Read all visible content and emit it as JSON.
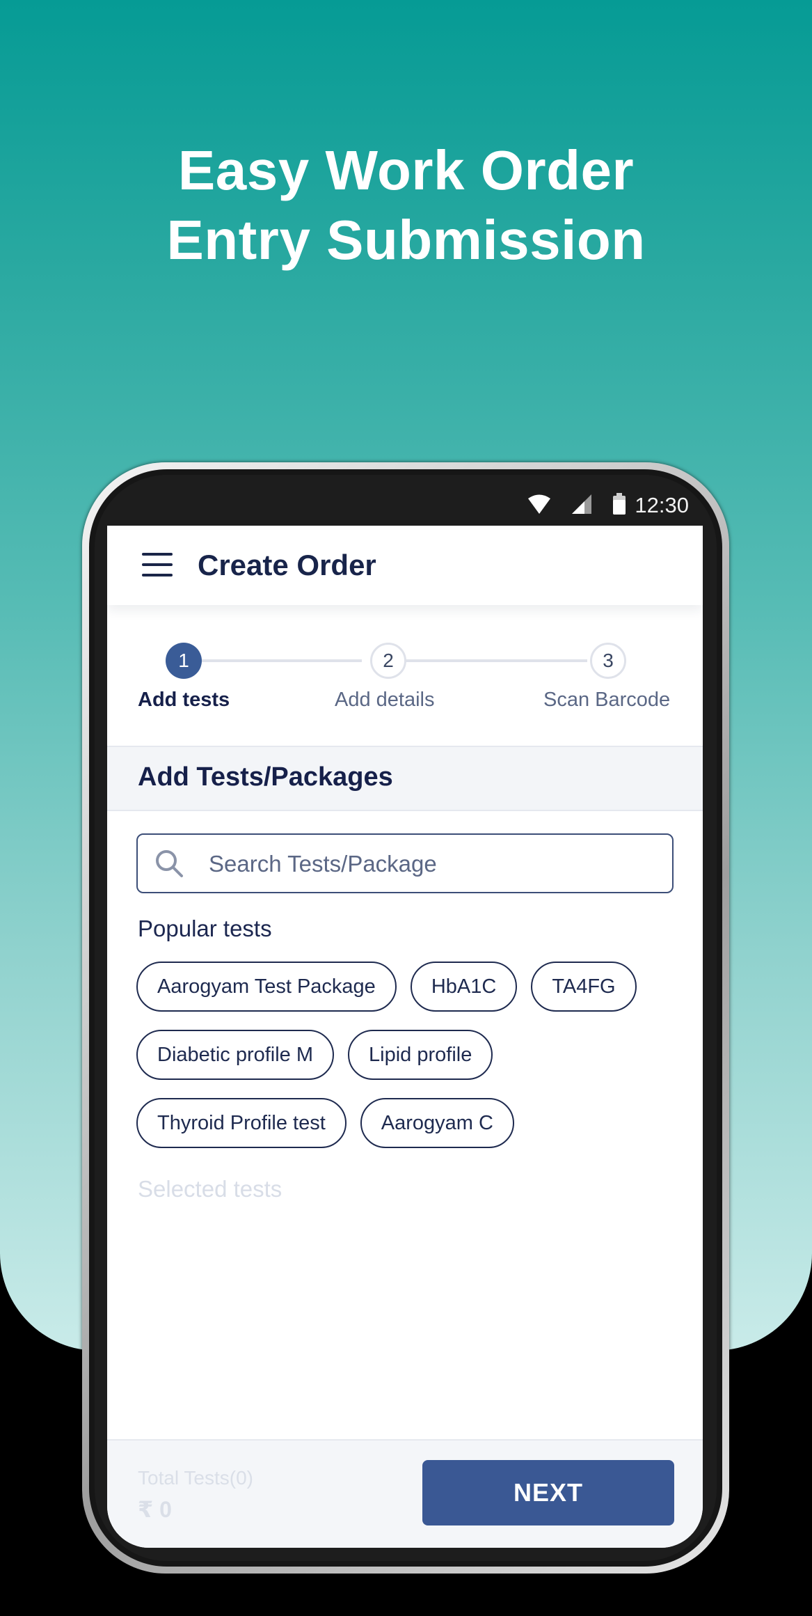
{
  "promo": {
    "headline_line1": "Easy Work Order",
    "headline_line2": "Entry Submission"
  },
  "status_bar": {
    "time": "12:30",
    "icons": [
      "wifi-icon",
      "signal-icon",
      "battery-icon"
    ]
  },
  "app_bar": {
    "title": "Create Order",
    "menu_icon": "menu-icon"
  },
  "stepper": {
    "steps": [
      {
        "number": "1",
        "label": "Add tests",
        "active": true
      },
      {
        "number": "2",
        "label": "Add details",
        "active": false
      },
      {
        "number": "3",
        "label": "Scan Barcode",
        "active": false
      }
    ]
  },
  "section": {
    "title": "Add Tests/Packages"
  },
  "search": {
    "placeholder": "Search Tests/Package",
    "value": ""
  },
  "popular": {
    "title": "Popular tests",
    "rows": [
      [
        "Aarogyam Test Package",
        "HbA1C",
        "TA4FG"
      ],
      [
        "Diabetic profile M",
        "Lipid profile"
      ],
      [
        "Thyroid Profile test",
        "Aarogyam C"
      ]
    ]
  },
  "selected": {
    "title": "Selected tests"
  },
  "footer": {
    "total_tests": "Total Tests(0)",
    "total_amount": "₹ 0",
    "next_label": "NEXT"
  },
  "colors": {
    "teal_top": "#069b95",
    "teal_bottom": "#c9ebe9",
    "primary": "#3a5894",
    "text_dark": "#16204a"
  }
}
